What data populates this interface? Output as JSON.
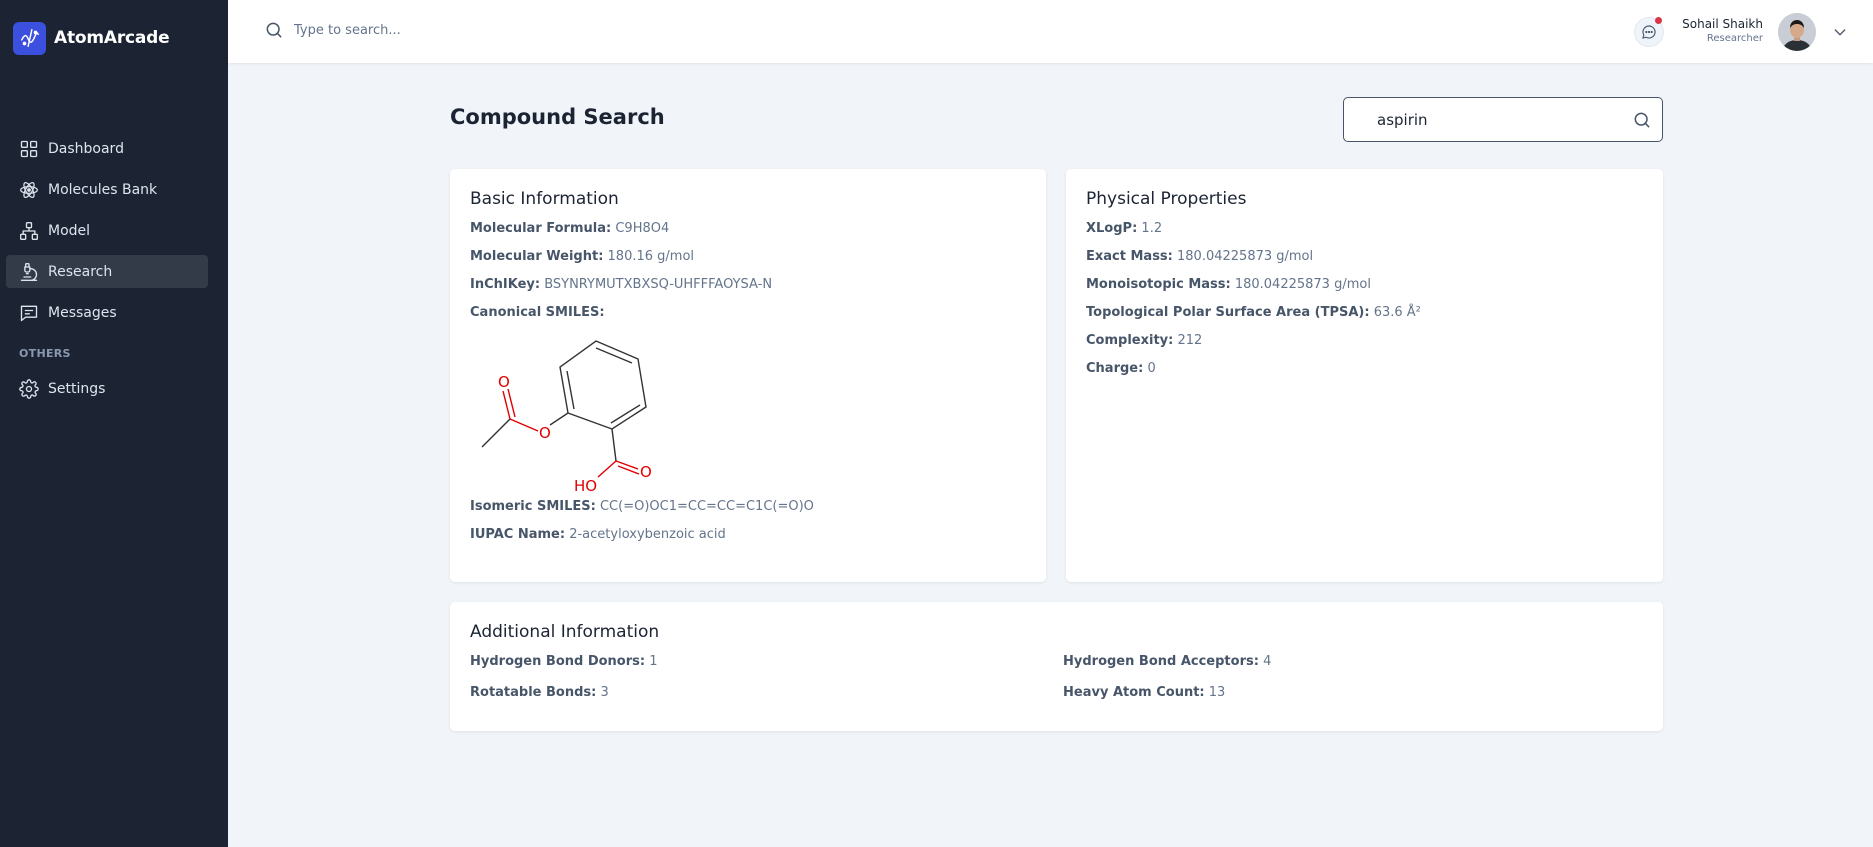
{
  "app": {
    "name": "AtomArcade"
  },
  "sidebar": {
    "items": [
      {
        "label": "Dashboard",
        "icon": "dashboard-icon"
      },
      {
        "label": "Molecules Bank",
        "icon": "atom-icon"
      },
      {
        "label": "Model",
        "icon": "hierarchy-icon"
      },
      {
        "label": "Research",
        "icon": "microscope-icon",
        "active": true
      },
      {
        "label": "Messages",
        "icon": "message-icon"
      }
    ],
    "section_label": "OTHERS",
    "others": [
      {
        "label": "Settings",
        "icon": "gear-icon"
      }
    ]
  },
  "header": {
    "search_placeholder": "Type to search...",
    "user_name": "Sohail Shaikh",
    "user_role": "Researcher"
  },
  "page": {
    "title": "Compound Search",
    "search_value": "aspirin"
  },
  "basic": {
    "title": "Basic Information",
    "molecular_formula": {
      "label": "Molecular Formula:",
      "value": "C9H8O4"
    },
    "molecular_weight": {
      "label": "Molecular Weight:",
      "value": "180.16 g/mol"
    },
    "inchikey": {
      "label": "InChIKey:",
      "value": "BSYNRYMUTXBXSQ-UHFFFAOYSA-N"
    },
    "canonical_smiles": {
      "label": "Canonical SMILES:"
    },
    "structure_labels": {
      "o1": "O",
      "o2": "O",
      "o3": "O",
      "ho": "HO"
    },
    "isomeric_smiles": {
      "label": "Isomeric SMILES:",
      "value": "CC(=O)OC1=CC=CC=C1C(=O)O"
    },
    "iupac_name": {
      "label": "IUPAC Name:",
      "value": "2-acetyloxybenzoic acid"
    }
  },
  "physical": {
    "title": "Physical Properties",
    "xlogp": {
      "label": "XLogP:",
      "value": "1.2"
    },
    "exact_mass": {
      "label": "Exact Mass:",
      "value": "180.04225873 g/mol"
    },
    "monoisotopic_mass": {
      "label": "Monoisotopic Mass:",
      "value": "180.04225873 g/mol"
    },
    "tpsa": {
      "label": "Topological Polar Surface Area (TPSA):",
      "value": "63.6 Å²"
    },
    "complexity": {
      "label": "Complexity:",
      "value": "212"
    },
    "charge": {
      "label": "Charge:",
      "value": "0"
    }
  },
  "additional": {
    "title": "Additional Information",
    "hbd": {
      "label": "Hydrogen Bond Donors:",
      "value": "1"
    },
    "hba": {
      "label": "Hydrogen Bond Acceptors:",
      "value": "4"
    },
    "rotatable": {
      "label": "Rotatable Bonds:",
      "value": "3"
    },
    "heavy_atoms": {
      "label": "Heavy Atom Count:",
      "value": "13"
    }
  },
  "colors": {
    "sidebar_bg": "#1c2434",
    "accent": "#3c50e0",
    "oxygen": "#e00000"
  }
}
